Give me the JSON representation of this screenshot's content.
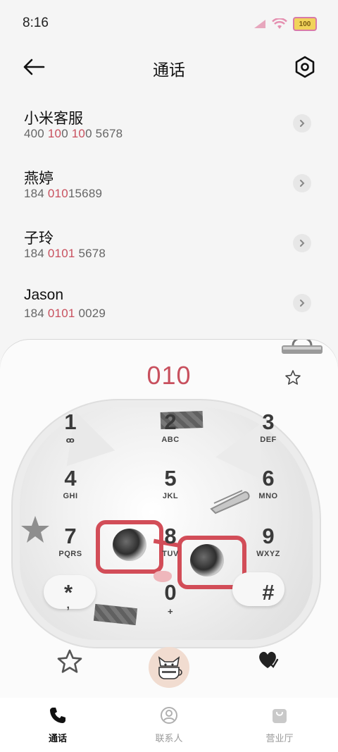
{
  "status_bar": {
    "time": "8:16",
    "battery": "100"
  },
  "header": {
    "title": "通话"
  },
  "contacts": [
    {
      "name": "小米客服",
      "number_parts": [
        "400 ",
        "10",
        "0 ",
        "10",
        "0 5678"
      ]
    },
    {
      "name": "燕婷",
      "number_parts": [
        "184 ",
        "010",
        "",
        "",
        "15689"
      ]
    },
    {
      "name": "子玲",
      "number_parts": [
        "184 ",
        "0101",
        "",
        "",
        " 5678"
      ]
    },
    {
      "name": "Jason",
      "number_parts": [
        "184 ",
        "0101",
        "",
        "",
        " 0029"
      ]
    }
  ],
  "dialer": {
    "digits": "010",
    "keys": [
      {
        "num": "1",
        "sub": "ꝏ"
      },
      {
        "num": "2",
        "sub": "ABC"
      },
      {
        "num": "3",
        "sub": "DEF"
      },
      {
        "num": "4",
        "sub": "GHI"
      },
      {
        "num": "5",
        "sub": "JKL"
      },
      {
        "num": "6",
        "sub": "MNO"
      },
      {
        "num": "7",
        "sub": "PQRS"
      },
      {
        "num": "8",
        "sub": "TUV"
      },
      {
        "num": "9",
        "sub": "WXYZ"
      },
      {
        "num": "*",
        "sub": ","
      },
      {
        "num": "0",
        "sub": "+"
      },
      {
        "num": "#",
        "sub": ""
      }
    ]
  },
  "bottom_nav": {
    "calls": "通话",
    "contacts": "联系人",
    "store": "营业厅"
  },
  "colors": {
    "accent": "#c8505e",
    "glasses": "#d24d58"
  }
}
